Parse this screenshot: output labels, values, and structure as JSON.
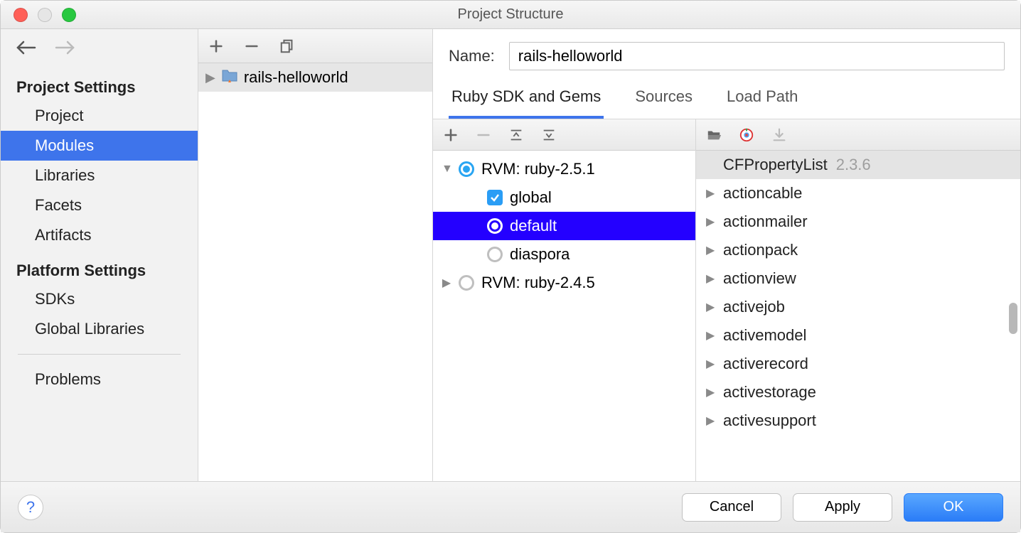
{
  "window": {
    "title": "Project Structure"
  },
  "sidebar": {
    "section1_title": "Project Settings",
    "items1": [
      "Project",
      "Modules",
      "Libraries",
      "Facets",
      "Artifacts"
    ],
    "selected1": 1,
    "section2_title": "Platform Settings",
    "items2": [
      "SDKs",
      "Global Libraries"
    ],
    "problems": "Problems"
  },
  "modules": {
    "module_name": "rails-helloworld"
  },
  "details": {
    "name_label": "Name:",
    "name_value": "rails-helloworld",
    "tabs": [
      "Ruby SDK and Gems",
      "Sources",
      "Load Path"
    ],
    "active_tab": 0
  },
  "sdk_tree": {
    "nodes": [
      {
        "label": "RVM: ruby-2.5.1",
        "kind": "radio",
        "checked": true,
        "expanded": true,
        "children": [
          {
            "label": "global",
            "kind": "checkbox",
            "checked": true
          },
          {
            "label": "default",
            "kind": "radio",
            "checked": true,
            "selected": true
          },
          {
            "label": "diaspora",
            "kind": "radio",
            "checked": false
          }
        ]
      },
      {
        "label": "RVM: ruby-2.4.5",
        "kind": "radio",
        "checked": false,
        "expanded": false
      }
    ]
  },
  "gems": [
    {
      "name": "CFPropertyList",
      "version": "2.3.6",
      "selected": true,
      "expanded": false,
      "no_tri": true
    },
    {
      "name": "actioncable"
    },
    {
      "name": "actionmailer"
    },
    {
      "name": "actionpack"
    },
    {
      "name": "actionview"
    },
    {
      "name": "activejob"
    },
    {
      "name": "activemodel"
    },
    {
      "name": "activerecord"
    },
    {
      "name": "activestorage"
    },
    {
      "name": "activesupport"
    }
  ],
  "footer": {
    "cancel": "Cancel",
    "apply": "Apply",
    "ok": "OK"
  }
}
